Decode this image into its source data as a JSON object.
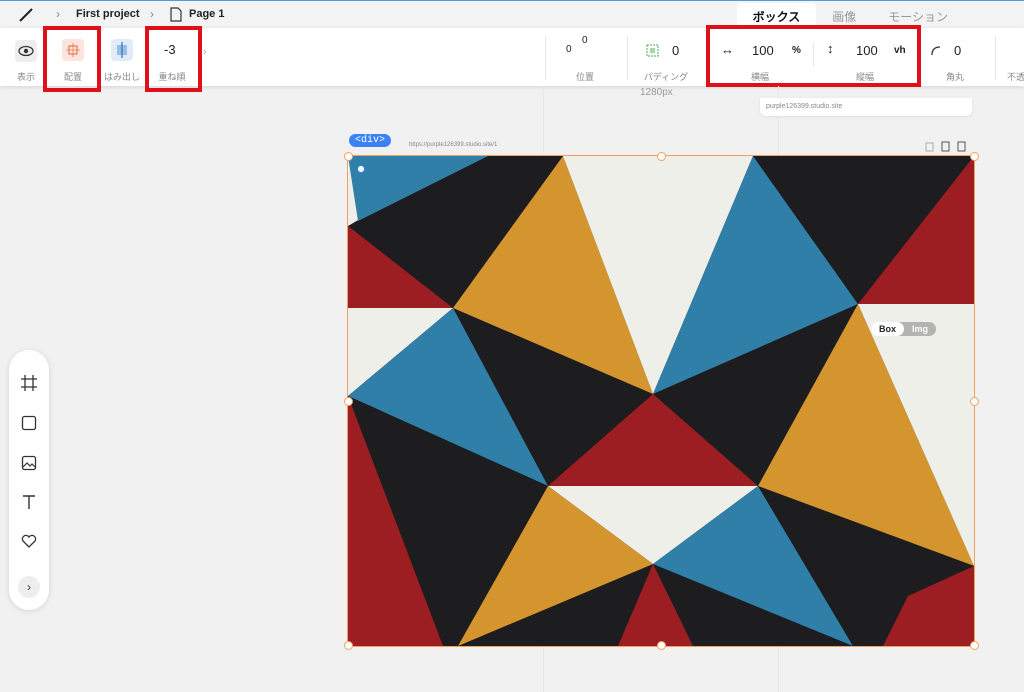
{
  "breadcrumb": {
    "project": "First project",
    "page": "Page 1"
  },
  "tabs": [
    {
      "label": "ボックス",
      "active": true
    },
    {
      "label": "画像",
      "active": false
    },
    {
      "label": "モーション",
      "active": false
    }
  ],
  "toolbar": {
    "visibility_label": "表示",
    "placement_label": "配置",
    "overflow_label": "はみ出し",
    "zindex_value": "-3",
    "zindex_label": "重ね順",
    "position_x": "0",
    "position_y": "0",
    "position_label": "位置",
    "padding_value": "0",
    "padding_label": "パディング",
    "width_value": "100",
    "width_unit": "%",
    "width_label": "横幅",
    "height_value": "100",
    "height_unit": "vh",
    "height_label": "縦幅",
    "radius_value": "0",
    "radius_label": "角丸",
    "opacity_label": "不透"
  },
  "canvas": {
    "breakpoint_label": "1280px",
    "site_url": "purple126399.studio.site",
    "page_url": "https://purple126399.studio.site/1",
    "element_tag": "<div>",
    "box_toggle": "Box",
    "img_toggle": "Img"
  },
  "colors": {
    "highlight": "#e0101a",
    "selection": "#f0a060",
    "tag": "#3b82f6",
    "mustard": "#d4952e",
    "teal": "#2f7fa8",
    "crimson": "#9c1e22",
    "charcoal": "#1d1c1f",
    "offwhite": "#efefea"
  },
  "palette_tools": [
    "frame-icon",
    "box-icon",
    "image-icon",
    "text-icon",
    "heart-icon",
    "expand-icon"
  ]
}
